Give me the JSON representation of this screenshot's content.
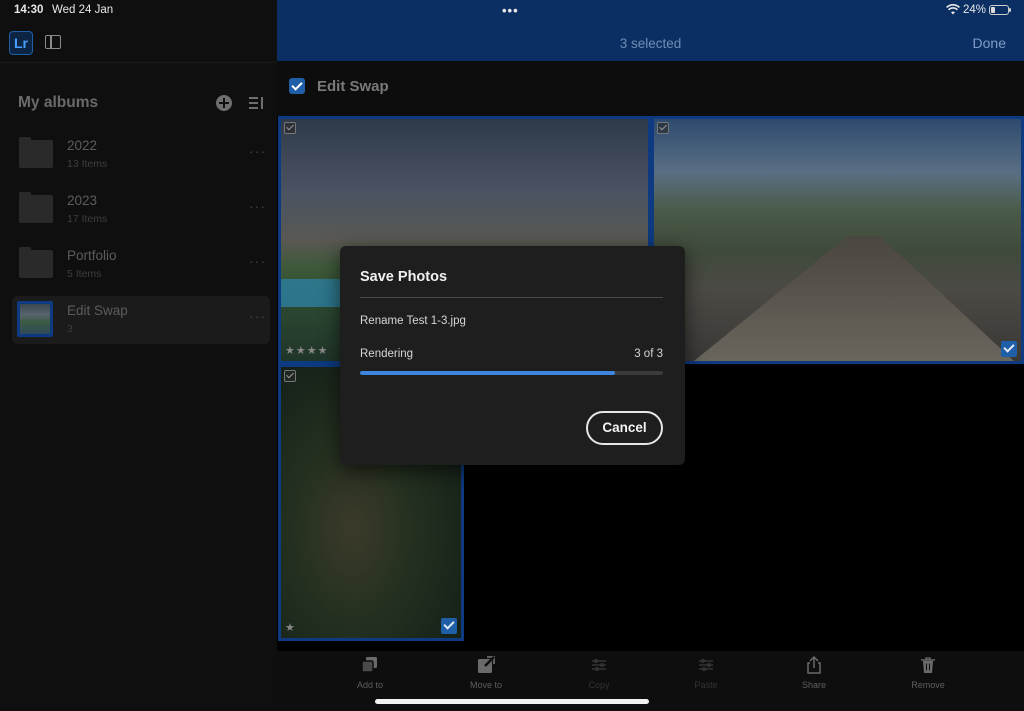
{
  "status_bar": {
    "time": "14:30",
    "date": "Wed 24 Jan",
    "multitask_dots": "•••",
    "wifi_icon": "wifi-icon",
    "battery_percent": "24%",
    "battery_icon": "battery-icon"
  },
  "sidebar": {
    "logo": "Lr",
    "albums_header": "My albums",
    "albums": [
      {
        "name": "2022",
        "count": "13 Items",
        "more": "···"
      },
      {
        "name": "2023",
        "count": "17 Items",
        "more": "···"
      },
      {
        "name": "Portfolio",
        "count": "5 Items",
        "more": "···"
      },
      {
        "name": "Edit Swap",
        "count": "3",
        "more": "···"
      }
    ]
  },
  "topbar": {
    "title": "3 selected",
    "done_label": "Done"
  },
  "album_view": {
    "title": "Edit Swap",
    "photos": [
      {
        "stars": "★★★★"
      },
      {
        "stars": "★★"
      },
      {
        "stars": "★"
      }
    ]
  },
  "dialog": {
    "title": "Save Photos",
    "file_name": "Rename Test 1-3.jpg",
    "status": "Rendering",
    "count": "3 of 3",
    "progress": 0.84,
    "cancel_label": "Cancel"
  },
  "toolbar": {
    "add_to": "Add to",
    "move_to": "Move to",
    "copy": "Copy",
    "paste": "Paste",
    "share": "Share",
    "remove": "Remove"
  },
  "colors": {
    "accent": "#3d86e0",
    "topbar": "#0c2f63",
    "selection_border": "#0d3a80"
  }
}
